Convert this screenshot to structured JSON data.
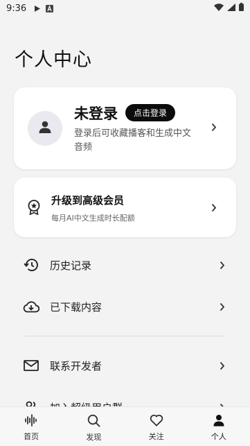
{
  "status_bar": {
    "time": "9:36",
    "icons": [
      "play-icon",
      "a-notification-icon",
      "wifi-icon",
      "signal-icon",
      "battery-icon"
    ]
  },
  "page": {
    "title": "个人中心"
  },
  "profile": {
    "name": "未登录",
    "login_button": "点击登录",
    "description": "登录后可收藏播客和生成中文音频"
  },
  "vip": {
    "title": "升级到高级会员",
    "subtitle": "每月AI中文生成时长配额"
  },
  "menu": {
    "items": [
      {
        "label": "历史记录",
        "icon": "history-icon"
      },
      {
        "label": "已下载内容",
        "icon": "cloud-download-icon"
      },
      {
        "label": "联系开发者",
        "icon": "mail-icon"
      },
      {
        "label": "加入超级用户群",
        "icon": "group-icon"
      }
    ]
  },
  "tabbar": {
    "tabs": [
      {
        "label": "首页",
        "icon": "waveform-icon"
      },
      {
        "label": "发现",
        "icon": "search-icon"
      },
      {
        "label": "关注",
        "icon": "heart-icon"
      },
      {
        "label": "个人",
        "icon": "person-icon",
        "active": true
      }
    ]
  },
  "colors": {
    "background": "#f3f3f3",
    "card": "#ffffff",
    "button": "#0c0c0c"
  }
}
